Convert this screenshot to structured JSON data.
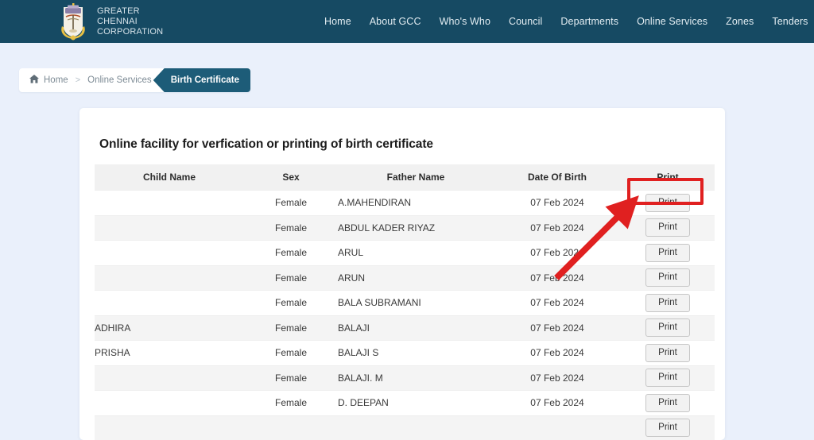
{
  "colors": {
    "header_bg": "#164a63",
    "page_bg": "#eaf0fb",
    "crumb_active_bg": "#1d5c78",
    "annotation_red": "#e02020",
    "table_header_bg": "#f1f1f1",
    "row_alt_bg": "#f4f4f4",
    "button_bg": "#f2f2f2"
  },
  "header": {
    "logo_icon": "gcc-emblem-icon",
    "brand_line1": "GREATER",
    "brand_line2": "CHENNAI",
    "brand_line3": "CORPORATION",
    "nav": [
      {
        "label": "Home"
      },
      {
        "label": "About GCC"
      },
      {
        "label": "Who's Who"
      },
      {
        "label": "Council"
      },
      {
        "label": "Departments"
      },
      {
        "label": "Online Services"
      },
      {
        "label": "Zones"
      },
      {
        "label": "Tenders"
      }
    ]
  },
  "breadcrumb": {
    "home_icon": "home-icon",
    "home_label": "Home",
    "separator": ">",
    "parent_label": "Online Services",
    "active_label": "Birth Certificate"
  },
  "main": {
    "title": "Online facility for verfication or printing of birth certificate",
    "table": {
      "columns": [
        "Child Name",
        "Sex",
        "Father Name",
        "Date Of Birth",
        "Print"
      ],
      "print_label": "Print",
      "rows": [
        {
          "child": "",
          "sex": "Female",
          "father": "A.MAHENDIRAN",
          "dob": "07 Feb 2024",
          "print": "Print"
        },
        {
          "child": "",
          "sex": "Female",
          "father": "ABDUL KADER RIYAZ",
          "dob": "07 Feb 2024",
          "print": "Print"
        },
        {
          "child": "",
          "sex": "Female",
          "father": "ARUL",
          "dob": "07 Feb 2024",
          "print": "Print"
        },
        {
          "child": "",
          "sex": "Female",
          "father": "ARUN",
          "dob": "07 Feb 2024",
          "print": "Print"
        },
        {
          "child": "",
          "sex": "Female",
          "father": "BALA SUBRAMANI",
          "dob": "07 Feb 2024",
          "print": "Print"
        },
        {
          "child": "ADHIRA",
          "sex": "Female",
          "father": "BALAJI",
          "dob": "07 Feb 2024",
          "print": "Print"
        },
        {
          "child": "PRISHA",
          "sex": "Female",
          "father": "BALAJI S",
          "dob": "07 Feb 2024",
          "print": "Print"
        },
        {
          "child": "",
          "sex": "Female",
          "father": "BALAJI. M",
          "dob": "07 Feb 2024",
          "print": "Print"
        },
        {
          "child": "",
          "sex": "Female",
          "father": "D. DEEPAN",
          "dob": "07 Feb 2024",
          "print": "Print"
        },
        {
          "child": "",
          "sex": "",
          "father": "",
          "dob": "",
          "print": "Print"
        }
      ]
    }
  },
  "annotations": {
    "highlight_target": "first-row-print-button",
    "arrow": "red-arrow-pointing-to-print-button"
  }
}
